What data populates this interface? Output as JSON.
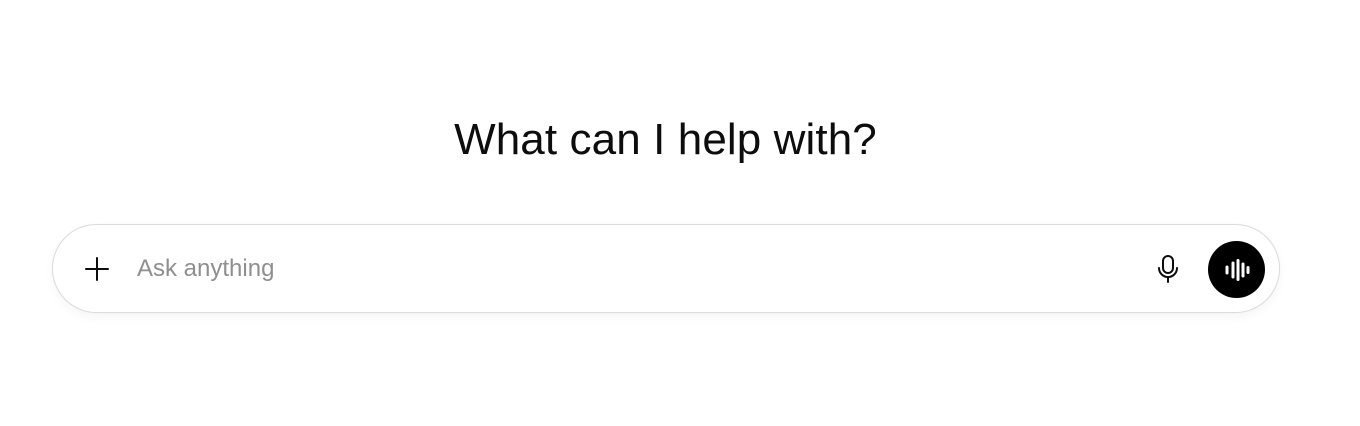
{
  "header": {
    "title": "What can I help with?"
  },
  "composer": {
    "placeholder": "Ask anything",
    "value": "",
    "icons": {
      "add": "plus-icon",
      "dictate": "microphone-icon",
      "voice_mode": "voice-waveform-icon"
    }
  },
  "colors": {
    "background": "#ffffff",
    "text": "#0d0d0d",
    "placeholder": "#8f8f8f",
    "composer_border": "#dcdcdc",
    "voice_button": "#000000"
  }
}
